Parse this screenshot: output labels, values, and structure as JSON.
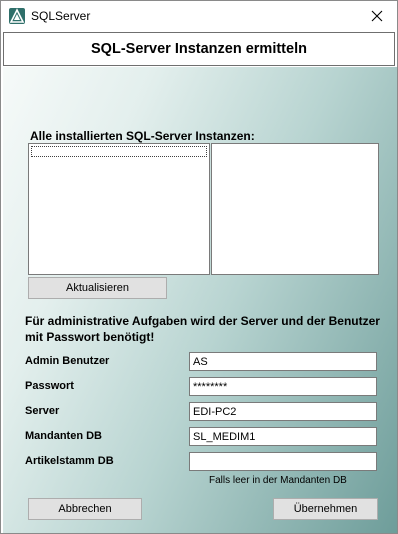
{
  "window": {
    "title": "SQLServer",
    "app_icon": "app-logo-icon",
    "close_icon": "close-icon"
  },
  "header": {
    "title": "SQL-Server Instanzen ermitteln"
  },
  "instances": {
    "section_title": "Alle installierten SQL-Server Instanzen:",
    "left_list_items": [],
    "right_list_items": [],
    "refresh_button": "Aktualisieren"
  },
  "admin": {
    "info_text": "Für administrative Aufgaben wird der Server und der Benutzer mit Passwort benötigt!"
  },
  "fields": {
    "admin_user": {
      "label": "Admin Benutzer",
      "value": "AS"
    },
    "password": {
      "label": "Passwort",
      "value": "********"
    },
    "server": {
      "label": "Server",
      "value": "EDI-PC2"
    },
    "client_db": {
      "label": "Mandanten DB",
      "value": "SL_MEDIM1"
    },
    "article_db": {
      "label": "Artikelstamm DB",
      "value": ""
    }
  },
  "hint": "Falls leer in der Mandanten DB",
  "buttons": {
    "cancel": "Abbrechen",
    "apply": "Übernehmen"
  },
  "colors": {
    "gradient_light": "#f6faf9",
    "gradient_dark": "#6e9d9a",
    "button_face": "#e1e1e1"
  }
}
